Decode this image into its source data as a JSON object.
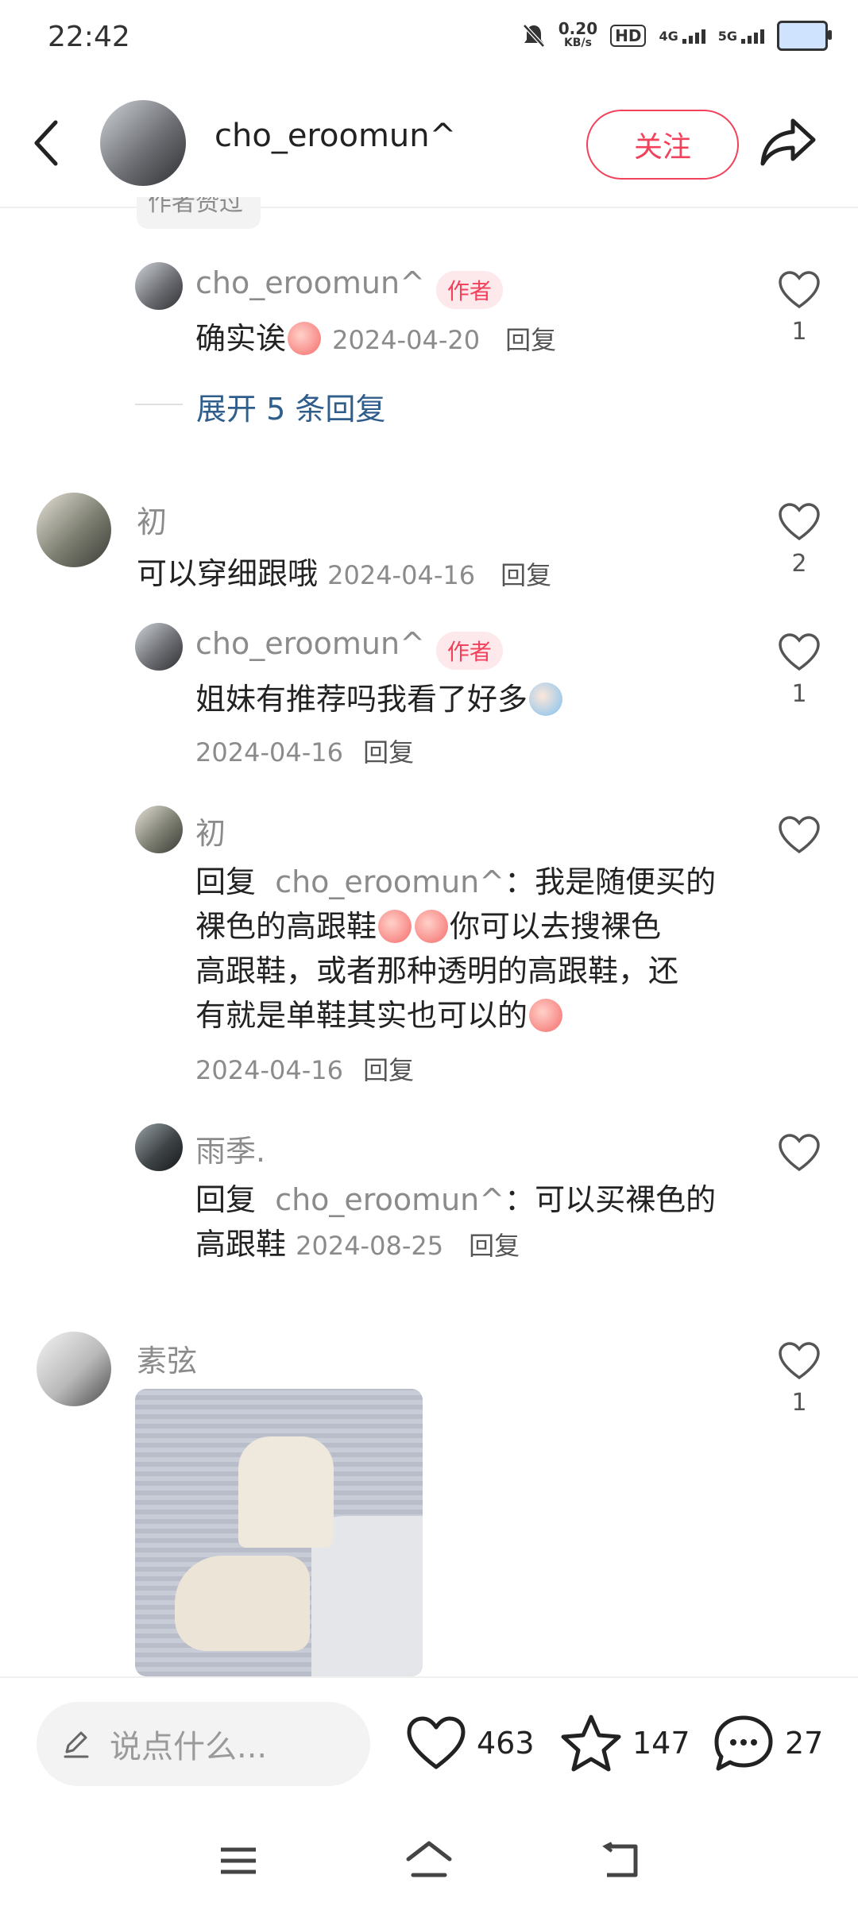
{
  "status_bar": {
    "time": "22:42",
    "net_speed_value": "0.20",
    "net_speed_unit": "KB/s",
    "hd": "HD",
    "net1": "4G",
    "net2": "5G"
  },
  "header": {
    "username": "cho_eroomun^",
    "follow_label": "关注"
  },
  "partial_tag": "作者赞过",
  "comments": [
    {
      "name": "cho_eroomun^",
      "badge": "作者",
      "text": "确实诶",
      "date": "2024-04-20",
      "reply": "回复",
      "likes": "1"
    },
    {
      "expand": "展开 5 条回复"
    },
    {
      "name": "初",
      "text": "可以穿细跟哦",
      "date": "2024-04-16",
      "reply": "回复",
      "likes": "2"
    },
    {
      "name": "cho_eroomun^",
      "badge": "作者",
      "text": "姐妹有推荐吗我看了好多",
      "date": "2024-04-16",
      "reply": "回复",
      "likes": "1"
    },
    {
      "name": "初",
      "reply_prefix": "回复",
      "reply_to": "cho_eroomun^",
      "line1": "：我是随便买的",
      "line2a": "裸色的高跟鞋",
      "line2b": "你可以去搜裸色",
      "line3": "高跟鞋，或者那种透明的高跟鞋，还",
      "line4": "有就是单鞋其实也可以的",
      "date": "2024-04-16",
      "reply": "回复"
    },
    {
      "name": "雨季.",
      "reply_prefix": "回复",
      "reply_to": "cho_eroomun^",
      "line1": "：可以买裸色的",
      "line2": "高跟鞋",
      "date": "2024-08-25",
      "reply": "回复"
    },
    {
      "name": "素弦",
      "likes": "1"
    }
  ],
  "bottom": {
    "placeholder": "说点什么...",
    "likes": "463",
    "stars": "147",
    "comments": "27"
  },
  "colors": {
    "accent": "#f2415a",
    "link": "#2f5d8c"
  }
}
